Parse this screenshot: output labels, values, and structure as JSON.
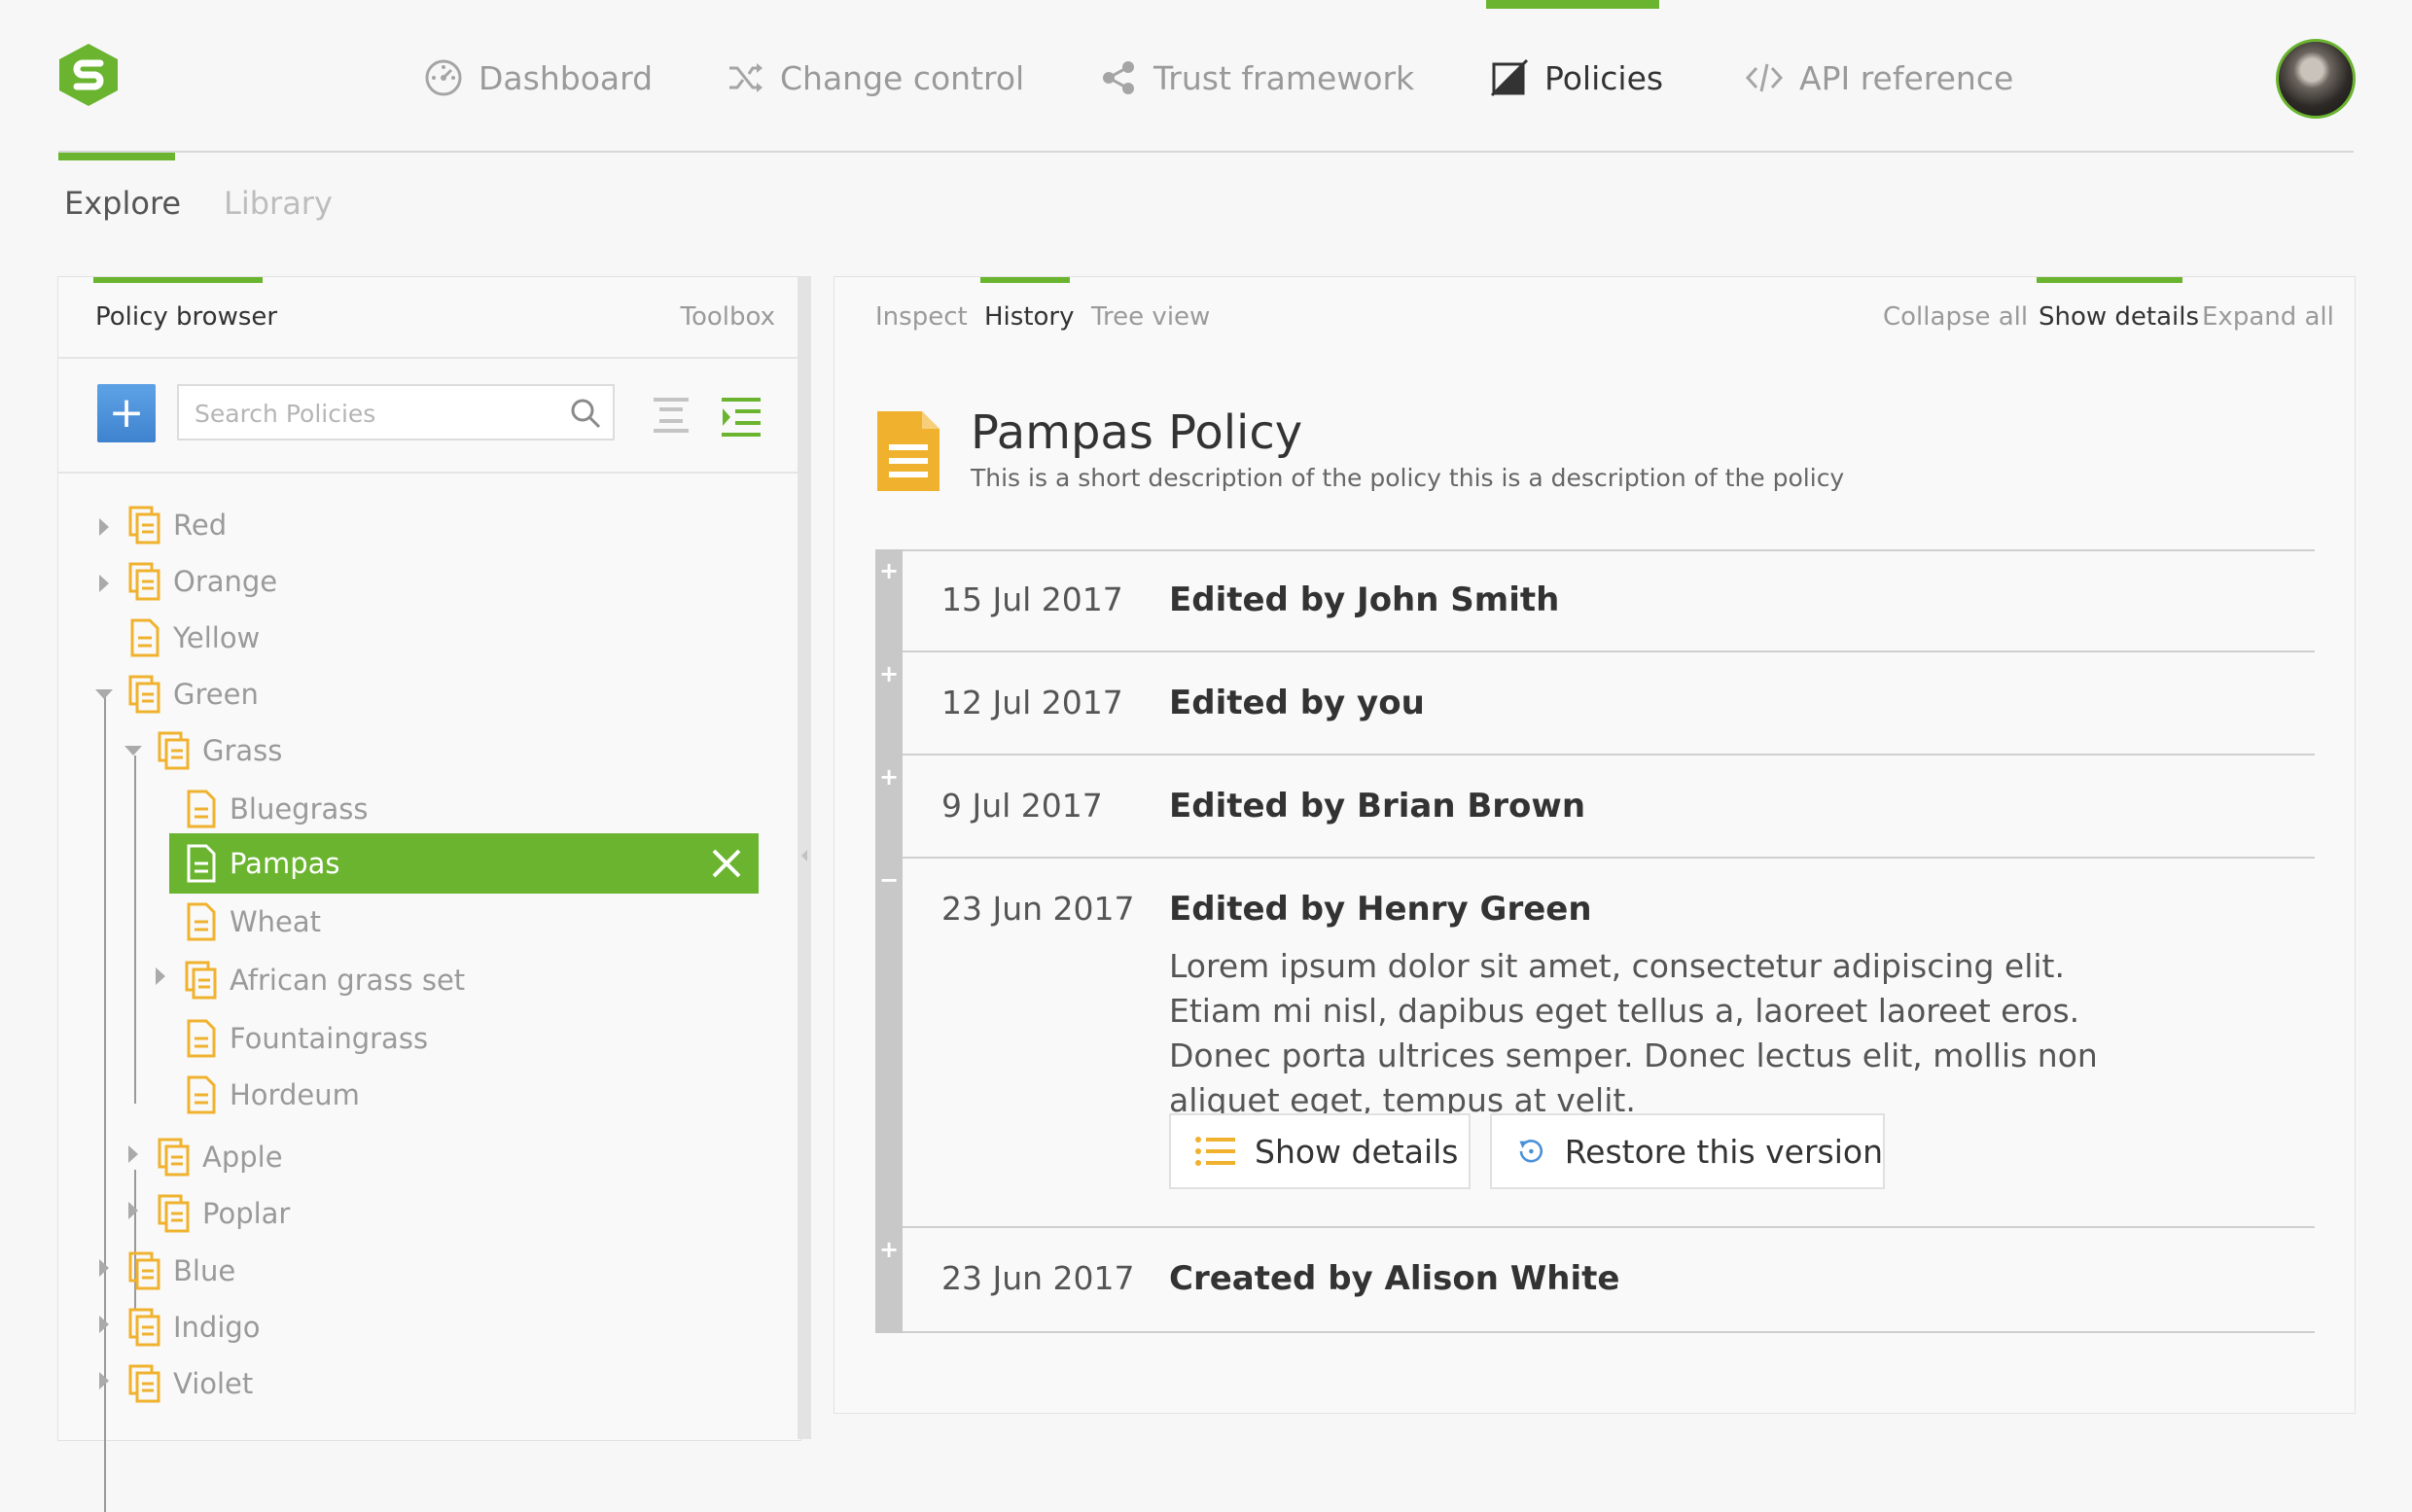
{
  "nav": {
    "items": [
      {
        "label": "Dashboard",
        "icon": "dashboard-gauge-icon"
      },
      {
        "label": "Change control",
        "icon": "shuffle-icon"
      },
      {
        "label": "Trust framework",
        "icon": "share-nodes-icon"
      },
      {
        "label": "Policies",
        "icon": "policy-square-icon"
      },
      {
        "label": "API reference",
        "icon": "code-icon"
      }
    ],
    "active": "Policies"
  },
  "subtabs": [
    {
      "label": "Explore"
    },
    {
      "label": "Library"
    }
  ],
  "left_panel": {
    "title": "Policy browser",
    "toolbox": "Toolbox",
    "add_label": "+",
    "search_placeholder": "Search Policies",
    "tree": [
      {
        "label": "Red"
      },
      {
        "label": "Orange"
      },
      {
        "label": "Yellow"
      },
      {
        "label": "Green"
      },
      {
        "label": "Grass"
      },
      {
        "label": "Bluegrass"
      },
      {
        "label": "Pampas"
      },
      {
        "label": "Wheat"
      },
      {
        "label": "African grass set"
      },
      {
        "label": "Fountaingrass"
      },
      {
        "label": "Hordeum"
      },
      {
        "label": "Apple"
      },
      {
        "label": "Poplar"
      },
      {
        "label": "Blue"
      },
      {
        "label": "Indigo"
      },
      {
        "label": "Violet"
      }
    ],
    "selected": "Pampas"
  },
  "right_panel": {
    "tabs_left": [
      {
        "label": "Inspect"
      },
      {
        "label": "History"
      },
      {
        "label": "Tree view"
      }
    ],
    "tabs_right": [
      {
        "label": "Collapse all"
      },
      {
        "label": "Show details"
      },
      {
        "label": "Expand all"
      }
    ],
    "active_left": "History",
    "active_right": "Show details",
    "policy_title": "Pampas Policy",
    "policy_desc": "This is a short description of the policy this is a description of the policy",
    "history": [
      {
        "date": "15 Jul 2017",
        "who": "Edited by John Smith",
        "toggle": "+"
      },
      {
        "date": "12 Jul 2017",
        "who": "Edited by you",
        "toggle": "+"
      },
      {
        "date": "9 Jul 2017",
        "who": "Edited by Brian Brown",
        "toggle": "+"
      },
      {
        "date": "23 Jun 2017",
        "who": "Edited by Henry Green",
        "toggle": "−",
        "body": "Lorem ipsum dolor sit amet, consectetur adipiscing elit. Etiam mi nisl, dapibus eget tellus a, laoreet laoreet eros. Donec porta ultrices semper. Donec lectus elit, mollis non aliquet eget, tempus at velit.",
        "buttons": [
          {
            "label": "Show details"
          },
          {
            "label": "Restore this version"
          }
        ]
      },
      {
        "date": "23 Jun 2017",
        "who": "Created by Alison White",
        "toggle": "+"
      }
    ]
  },
  "colors": {
    "accent": "#6ab42f",
    "doc_icon": "#f0b22e",
    "add_button": "#4a90d9"
  }
}
